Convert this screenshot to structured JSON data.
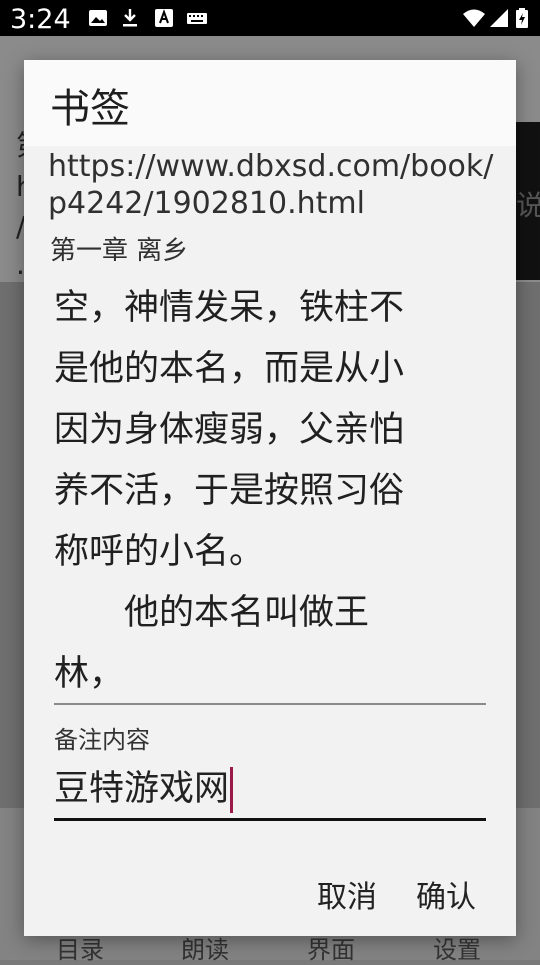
{
  "status_bar": {
    "time": "3:24",
    "icons_left": [
      "image-icon",
      "download-icon",
      "font-icon",
      "keyboard-icon"
    ],
    "icons_right": [
      "wifi-icon",
      "cell-signal-icon",
      "battery-icon"
    ]
  },
  "background": {
    "text_fragments": [
      "第",
      "h",
      "/",
      "."
    ],
    "side_char": "说",
    "nav": [
      "目录",
      "朗读",
      "界面",
      "设置"
    ]
  },
  "dialog": {
    "title": "书签",
    "url": "https://www.dbxsd.com/book/p4242/1902810.html",
    "chapter": "第一章 离乡",
    "excerpt": "空，神情发呆，铁柱不\n是他的本名，而是从小\n因为身体瘦弱，父亲怕\n养不活，于是按照习俗\n称呼的小名。\n　　他的本名叫做王\n林，",
    "note": {
      "label": "备注内容",
      "value": "豆特游戏网"
    },
    "buttons": {
      "cancel": "取消",
      "confirm": "确认"
    }
  }
}
